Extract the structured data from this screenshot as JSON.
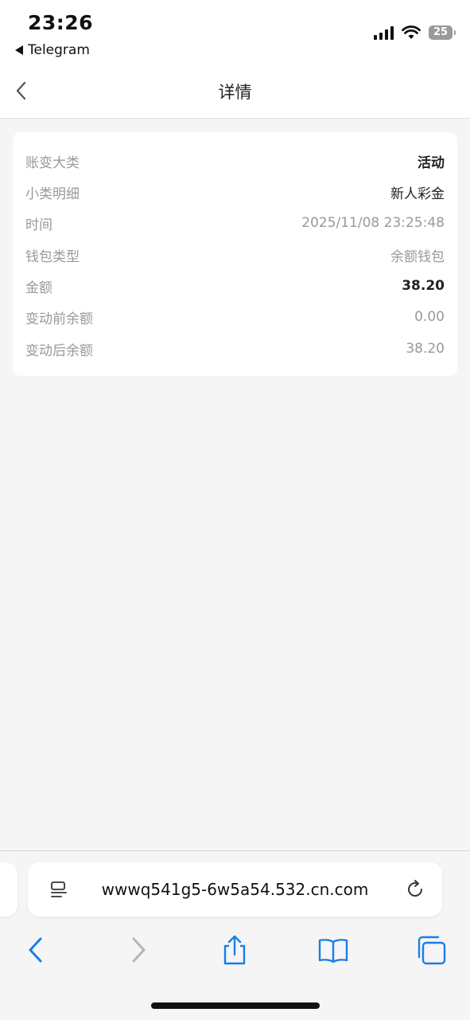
{
  "status_bar": {
    "time": "23:26",
    "back_app": "Telegram",
    "battery": "25"
  },
  "navbar": {
    "title": "详情"
  },
  "details": [
    {
      "label": "账变大类",
      "value": "活动",
      "style": "bold"
    },
    {
      "label": "小类明细",
      "value": "新人彩金",
      "style": "dark"
    },
    {
      "label": "时间",
      "value": "2025/11/08 23:25:48",
      "style": "muted"
    },
    {
      "label": "钱包类型",
      "value": "余额钱包",
      "style": "muted"
    },
    {
      "label": "金额",
      "value": "38.20",
      "style": "bold"
    },
    {
      "label": "变动前余额",
      "value": "0.00",
      "style": "muted"
    },
    {
      "label": "变动后余额",
      "value": "38.20",
      "style": "muted"
    }
  ],
  "browser": {
    "url": "wwwq541g5-6w5a54.532.cn.com",
    "accent_color": "#1a7ee6",
    "disabled_color": "#b5b5b5",
    "toolbar_icons": [
      "back-icon",
      "forward-icon",
      "share-icon",
      "bookmarks-icon",
      "tabs-icon"
    ]
  }
}
